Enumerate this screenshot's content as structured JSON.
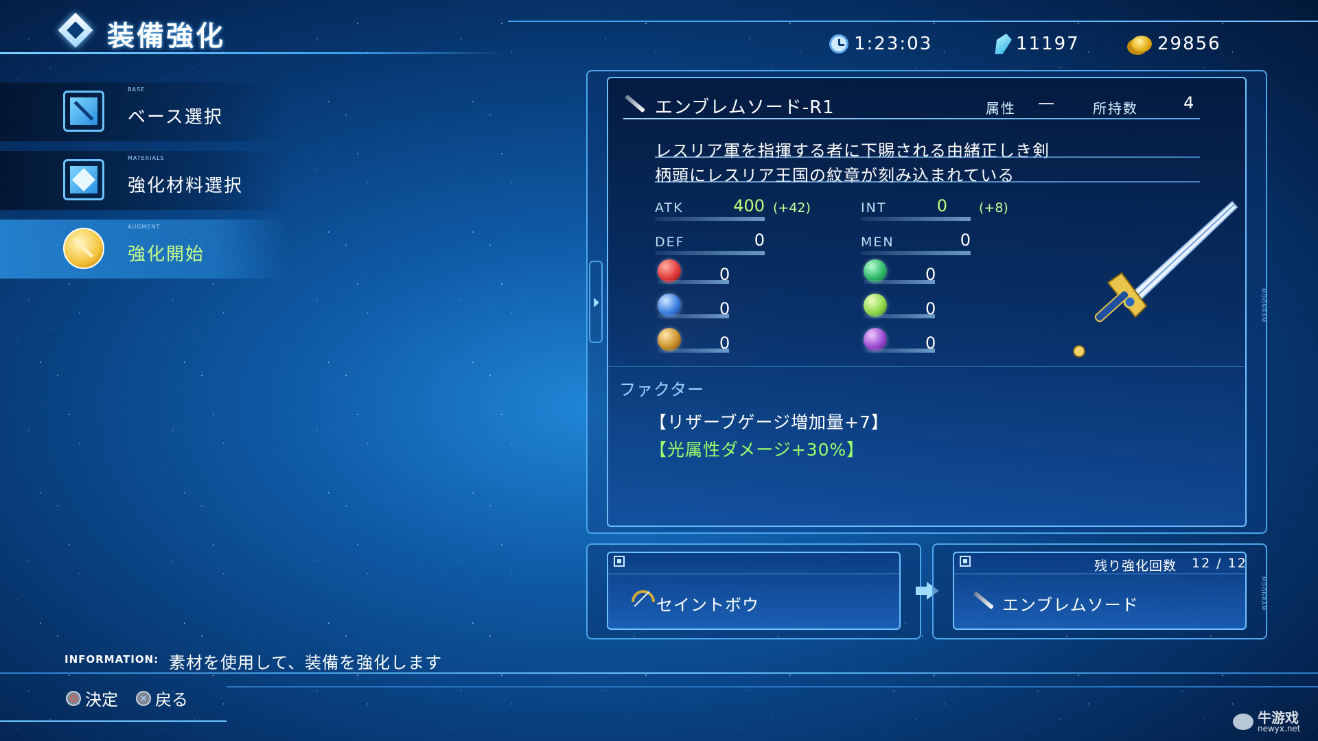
{
  "header": {
    "title": "装備強化",
    "time": "1:23:03",
    "crystals": "11197",
    "gold": "29856"
  },
  "menu": {
    "items": [
      {
        "small": "BASE",
        "label": "ベース選択",
        "icon": "sword-icon"
      },
      {
        "small": "MATERIALS",
        "label": "強化材料選択",
        "icon": "diamond-icon"
      },
      {
        "small": "AUGMENT",
        "label": "強化開始",
        "icon": "gold-sword-icon",
        "active": true
      }
    ]
  },
  "item": {
    "name": "エンブレムソード-R1",
    "attribute_label": "属性",
    "attribute_value": "—",
    "owned_label": "所持数",
    "owned_value": "4",
    "desc_line1": "レスリア軍を指揮する者に下賜される由緒正しき剣",
    "desc_line2": "柄頭にレスリア王国の紋章が刻み込まれている"
  },
  "stats": {
    "atk_label": "ATK",
    "atk_value": "400",
    "atk_bonus": "(+42)",
    "int_label": "INT",
    "int_value": "0",
    "int_bonus": "(+8)",
    "def_label": "DEF",
    "def_value": "0",
    "men_label": "MEN",
    "men_value": "0"
  },
  "elements": [
    {
      "icon": "fire-orb-icon",
      "value": "0",
      "color": "#e23a3a"
    },
    {
      "icon": "wind-orb-icon",
      "value": "0",
      "color": "#2fb86a"
    },
    {
      "icon": "water-orb-icon",
      "value": "0",
      "color": "#3a7fe0"
    },
    {
      "icon": "light-orb-icon",
      "value": "0",
      "color": "#8ed84a"
    },
    {
      "icon": "earth-orb-icon",
      "value": "0",
      "color": "#c9902a"
    },
    {
      "icon": "dark-orb-icon",
      "value": "0",
      "color": "#9a4ad0"
    }
  ],
  "factors": {
    "title": "ファクター",
    "items": [
      {
        "text": "【リザーブゲージ増加量+7】",
        "color": "#ffffff"
      },
      {
        "text": "【光属性ダメージ+30%】",
        "color": "#9dff6a"
      }
    ]
  },
  "slots": {
    "material": "セイントボウ",
    "result": "エンブレムソード",
    "remaining_label": "残り強化回数",
    "remaining_value": "12 / 12"
  },
  "footer": {
    "info_label": "INFORMATION:",
    "info_text": "素材を使用して、装備を強化します",
    "confirm": "決定",
    "back": "戻る"
  },
  "watermark": {
    "title": "牛游戏",
    "url": "newyx.net"
  }
}
